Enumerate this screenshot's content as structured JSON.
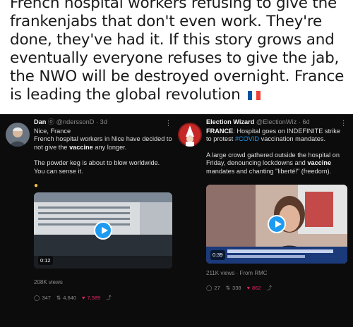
{
  "caption": {
    "text": "French hospital workers refusing to give the frankenjabs that don't even work. They're done, they've had it. If this story grows and eventually everyone refuses to give the jab, the NWO will be destroyed overnight. France is leading the global revolution",
    "flag": [
      "#0055a4",
      "#ffffff",
      "#ef4135"
    ]
  },
  "tweet1": {
    "name": "Dan",
    "handle": "@ndersson​D",
    "time": "3d",
    "line1": "Nice, France",
    "line2_pre": "French hospital workers in Nice have decided to not give the ",
    "line2_bold": "vaccine",
    "line2_post": " any longer.",
    "para2": "The powder keg is about to blow worldwide. You can sense it.",
    "duration": "0:12",
    "views": "208K views",
    "replies": "347",
    "retweets": "4,640",
    "likes": "7,589"
  },
  "tweet2": {
    "name": "Election Wizard",
    "handle": "@ElectionWiz",
    "time": "6d",
    "p1_bold": "FRANCE",
    "p1_a": ": Hospital goes on INDEFINITE strike to protest ",
    "p1_tag": "#COVID",
    "p1_b": " vaccination mandates.",
    "p2_a": "A large crowd gathered outside the hospital on Friday, denouncing lockdowns and ",
    "p2_bold": "vaccine",
    "p2_b": " mandates and chanting \"liberté!\" (freedom).",
    "duration": "0:39",
    "views": "211K views · From RMC",
    "replies": "27",
    "retweets": "338",
    "likes": "862"
  }
}
